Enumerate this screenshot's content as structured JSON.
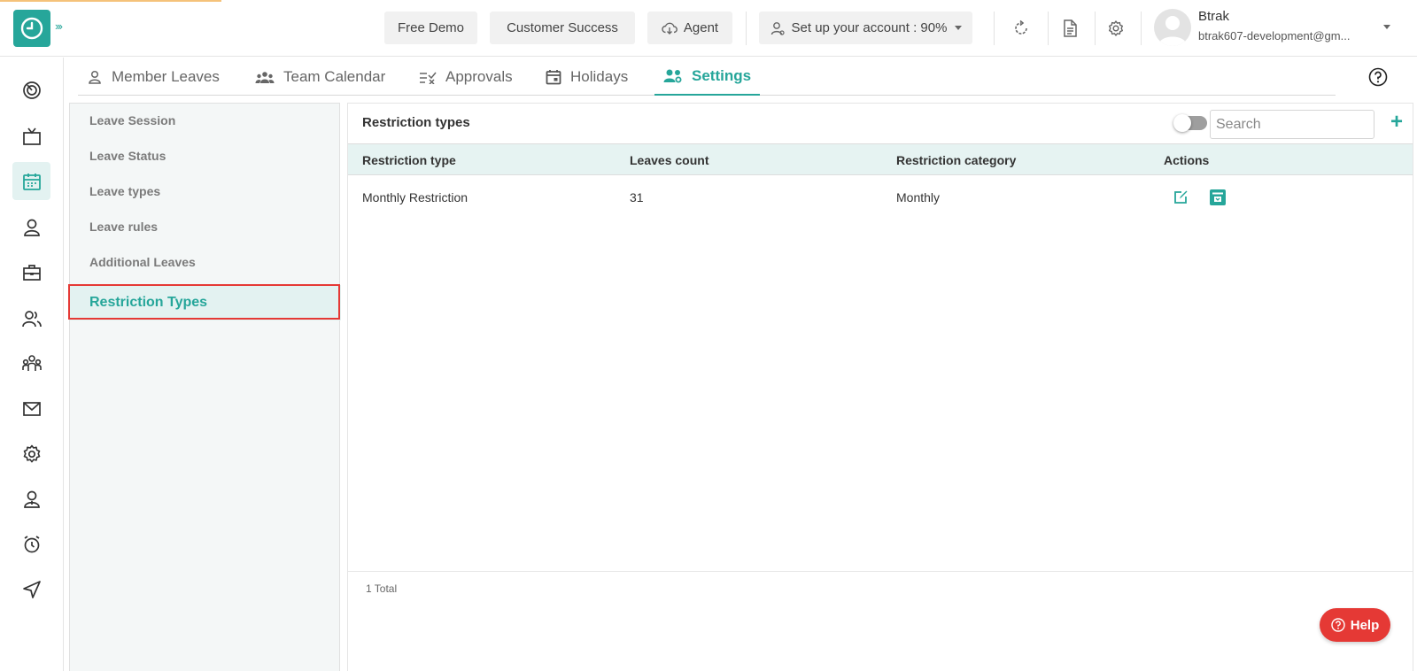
{
  "header": {
    "buttons": {
      "free_demo": "Free Demo",
      "customer_success": "Customer Success",
      "agent": "Agent",
      "setup": "Set up your account : 90%"
    },
    "user": {
      "name": "Btrak",
      "email": "btrak607-development@gm..."
    }
  },
  "tabs": [
    {
      "label": "Member Leaves",
      "icon": "person-icon"
    },
    {
      "label": "Team Calendar",
      "icon": "team-icon"
    },
    {
      "label": "Approvals",
      "icon": "approvals-icon"
    },
    {
      "label": "Holidays",
      "icon": "calendar-icon"
    },
    {
      "label": "Settings",
      "icon": "settings-people-icon"
    }
  ],
  "settings_menu": {
    "items": [
      "Leave Session",
      "Leave Status",
      "Leave types",
      "Leave rules",
      "Additional Leaves",
      "Restriction Types"
    ],
    "active": "Restriction Types"
  },
  "panel": {
    "title": "Restriction types",
    "search_placeholder": "Search",
    "columns": [
      "Restriction type",
      "Leaves count",
      "Restriction category",
      "Actions"
    ],
    "rows": [
      {
        "type": "Monthly Restriction",
        "count": "31",
        "category": "Monthly"
      }
    ],
    "total": "1 Total"
  },
  "help_button": "Help",
  "colors": {
    "accent": "#26a69a",
    "highlight": "#e53935",
    "help": "#e53935"
  }
}
